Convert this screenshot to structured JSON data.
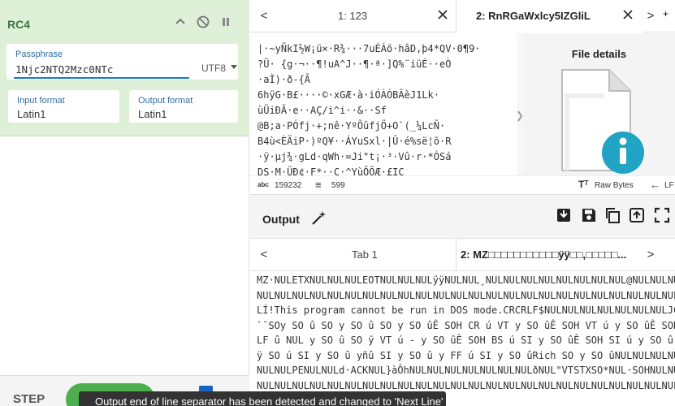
{
  "operation": {
    "title": "RC4",
    "passphrase_label": "Passphrase",
    "passphrase_value": "1Njc2NTQ2Mzc0NTc",
    "encoding": "UTF8",
    "input_format_label": "Input format",
    "input_format_value": "Latin1",
    "output_format_label": "Output format",
    "output_format_value": "Latin1"
  },
  "controls": {
    "step_label": "STEP"
  },
  "input": {
    "tabs": [
      {
        "label": "1: 123"
      },
      {
        "label": "2: RnRGaWxlcy5IZGliL"
      }
    ],
    "lines": [
      "|·~yÑkI½W¡ü×·R¾···7uÉÁõ·hâD,þ4*QV·0¶9·",
      "?Ü· {g·¬··¶!uA^J··¶·ª·]Q%¨iüÉ··eÒ",
      "·aÌ)·ð-{Ã",
      "6hÿG·B£····©·xGÆ·à·iÓÀÓBÂèJ1Lk·",
      "ùÜiÐÃ·e··AÇ/i^i··&··Sf",
      "@B;a·PÓfj·+;nê·YºÕûfjÖ+O`(_¼LcÑ·",
      "B4ù<ÈÄiP·)ºQ¥··ÁYuSxl·|Û·é%së¦õ·R",
      "·ÿ·µj¾·gLd·qWh·=Ji\"t¡·³·Vû·r·*ÓSá",
      "DS·M·ÜÐ¢·F*··Ç·^YùÕÖÆ·£IÇ"
    ],
    "file_details_title": "File details",
    "status": {
      "length": "159232",
      "lines": "599",
      "raw_bytes": "Raw Bytes",
      "lf": "LF"
    }
  },
  "output": {
    "title": "Output",
    "tabs": [
      {
        "label": "Tab 1"
      },
      {
        "label": "2: MZ□□□□□□□□□□□ÿÿ□□,□□□□□..."
      }
    ],
    "lines": [
      "MZ·NULETXNULNULNULEOTNULNULNULÿÿNULNUL¸NULNULNULNULNULNULNULNUL@NULNULNULNULNULNULNULNULNULNULNULNULNUL",
      "NULNULNULNULNULNULNULNULNULNULNULNULNULNULNULNULNULNULNULNULNULNULNULNULNULNULDLEOHNULNULSOº´Í!¸SOH",
      "LÍ!This program cannot be run in DOS mode.CRCRLF$NULNULNULNULNULNULNULJCAN",
      "`¨SOy SO û SO y SO û SO y SO ûÊ SOH CR ú VT y SO ûÊ SOH VT ú y SO ûÊ SOH LF ú ETB y SO û SO ÿ CR û BEL y SO û SO ÿ",
      "LF û NUL y SO û SO ÿ VT ú - y SO ûÊ SOH BS ú SI y SO ûÊ SOH SI ú  y SO û SO ÿ SI û oy SO û yë BEL FF y SO û",
      "ÿ SO ú SI y SO û yñû SI y SO û y FF ú SI y SO ûRich SO y SO ûNULNULNULNULNULNULNULNULNULNULNULNULNUL",
      "NULNULPENULNULd·ACKNUL}àÔhNULNULNULNULNULNULNULðNUL\"VTSTXSO*NUL·SOHNULNULINULNULNULNULNULNULNUL",
      "NULNULNULNULNULNULNULNULNULNULNULNULNULNULNULNULNULNULNULNULNULNULNULNULNULNULNULNULNULNULNULNULNULNUL"
    ]
  },
  "toast": {
    "text": "Output end of line separator has been detected and changed to 'Next Line'"
  }
}
